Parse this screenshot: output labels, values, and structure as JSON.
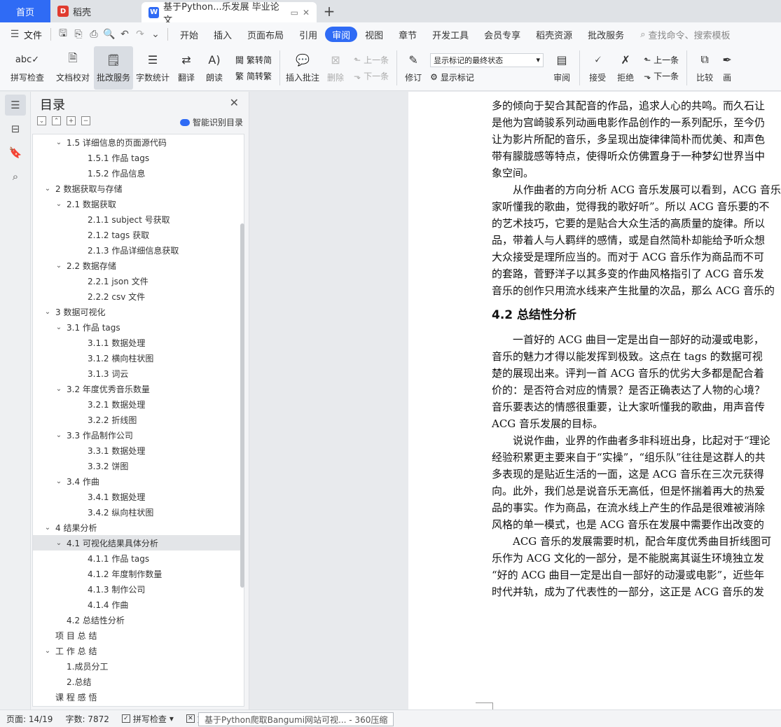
{
  "tabs": {
    "home": "首页",
    "daoke": "稻壳",
    "doc_title": "基于Python...乐发展 毕业论文",
    "add": "+"
  },
  "menu": {
    "file": "文件",
    "items": [
      "开始",
      "插入",
      "页面布局",
      "引用",
      "审阅",
      "视图",
      "章节",
      "开发工具",
      "会员专享",
      "稻壳资源",
      "批改服务"
    ],
    "active": "审阅",
    "search_placeholder": "查找命令、搜索模板"
  },
  "ribbon": {
    "spellcheck": "拼写检查",
    "doc_proof": "文档校对",
    "correction": "批改服务",
    "word_count": "字数统计",
    "translate": "翻译",
    "read_aloud": "朗读",
    "trad_to_simp": "繁转简",
    "simp_to_trad": "简转繁",
    "insert_comment": "插入批注",
    "delete": "删除",
    "prev_comment": "上一条",
    "next_comment": "下一条",
    "track_changes": "修订",
    "markup_state": "显示标记的最终状态",
    "show_markup": "显示标记",
    "review": "审阅",
    "accept": "接受",
    "reject": "拒绝",
    "prev_change": "上一条",
    "next_change": "下一条",
    "compare": "比较",
    "last_partial": "画"
  },
  "toc": {
    "title": "目录",
    "smart": "智能识别目录",
    "items": [
      {
        "level": 2,
        "arrow": true,
        "text": "1.5  详细信息的页面源代码"
      },
      {
        "level": 3,
        "arrow": false,
        "text": "1.5.1  作品 tags"
      },
      {
        "level": 3,
        "arrow": false,
        "text": "1.5.2  作品信息"
      },
      {
        "level": 1,
        "arrow": true,
        "text": "2    数据获取与存储"
      },
      {
        "level": 2,
        "arrow": true,
        "text": "2.1 数据获取"
      },
      {
        "level": 3,
        "arrow": false,
        "text": "2.1.1 subject 号获取"
      },
      {
        "level": 3,
        "arrow": false,
        "text": "2.1.2 tags 获取"
      },
      {
        "level": 3,
        "arrow": false,
        "text": "2.1.3  作品详细信息获取"
      },
      {
        "level": 2,
        "arrow": true,
        "text": "2.2 数据存储"
      },
      {
        "level": 3,
        "arrow": false,
        "text": "2.2.1 json 文件"
      },
      {
        "level": 3,
        "arrow": false,
        "text": "2.2.2 csv 文件"
      },
      {
        "level": 1,
        "arrow": true,
        "text": "3    数据可视化"
      },
      {
        "level": 2,
        "arrow": true,
        "text": "3.1 作品 tags"
      },
      {
        "level": 3,
        "arrow": false,
        "text": "3.1.1  数据处理"
      },
      {
        "level": 3,
        "arrow": false,
        "text": "3.1.2  横向柱状图"
      },
      {
        "level": 3,
        "arrow": false,
        "text": "3.1.3  词云"
      },
      {
        "level": 2,
        "arrow": true,
        "text": "3.2 年度优秀音乐数量"
      },
      {
        "level": 3,
        "arrow": false,
        "text": "3.2.1  数据处理"
      },
      {
        "level": 3,
        "arrow": false,
        "text": "3.2.2  折线图"
      },
      {
        "level": 2,
        "arrow": true,
        "text": "3.3 作品制作公司"
      },
      {
        "level": 3,
        "arrow": false,
        "text": "3.3.1  数据处理"
      },
      {
        "level": 3,
        "arrow": false,
        "text": "3.3.2  饼图"
      },
      {
        "level": 2,
        "arrow": true,
        "text": "3.4 作曲"
      },
      {
        "level": 3,
        "arrow": false,
        "text": "3.4.1  数据处理"
      },
      {
        "level": 3,
        "arrow": false,
        "text": "3.4.2  纵向柱状图"
      },
      {
        "level": 1,
        "arrow": true,
        "text": "4    结果分析"
      },
      {
        "level": 2,
        "arrow": true,
        "text": "4.1  可视化结果具体分析",
        "selected": true
      },
      {
        "level": 3,
        "arrow": false,
        "text": "4.1.1 作品 tags"
      },
      {
        "level": 3,
        "arrow": false,
        "text": "4.1.2 年度制作数量"
      },
      {
        "level": 3,
        "arrow": false,
        "text": "4.1.3 制作公司"
      },
      {
        "level": 3,
        "arrow": false,
        "text": "4.1.4 作曲"
      },
      {
        "level": 2,
        "arrow": false,
        "text": "4.2 总结性分析"
      },
      {
        "level": 1,
        "arrow": false,
        "text": "项 目 总 结"
      },
      {
        "level": 1,
        "arrow": true,
        "text": "工 作 总 结"
      },
      {
        "level": 2,
        "arrow": false,
        "text": "1.成员分工"
      },
      {
        "level": 2,
        "arrow": false,
        "text": "2.总结"
      },
      {
        "level": 1,
        "arrow": false,
        "text": "课 程 感 悟"
      }
    ]
  },
  "document": {
    "lines_before": [
      "多的倾向于契合其配音的作品，追求人心的共鸣。而久石让",
      "是他为宫崎骏系列动画电影作品创作的一系列配乐，至今仍",
      "让为影片所配的音乐，多呈现出旋律律简朴而优美、和声色",
      "带有朦胧感等特点，使得听众仿佛置身于一种梦幻世界当中",
      "象空间。",
      "　　从作曲者的方向分析 ACG 音乐发展可以看到，ACG 音乐",
      "家听懂我的歌曲，觉得我的歌好听”。所以 ACG 音乐要的不",
      "的艺术技巧，它要的是贴合大众生活的高质量的旋律。所以",
      "品，带着人与人羁绊的感情，或是自然简朴却能给予听众想",
      "大众接受是理所应当的。而对于 ACG 音乐作为商品而不可",
      "的套路，菅野洋子以其多变的作曲风格指引了 ACG 音乐发",
      "音乐的创作只用流水线来产生批量的次品，那么 ACG 音乐的"
    ],
    "heading": "4.2 总结性分析",
    "lines_after": [
      "　　一首好的 ACG 曲目一定是出自一部好的动漫或电影，",
      "音乐的魅力才得以能发挥到极致。这点在 tags 的数据可视",
      "楚的展现出来。评判一首 ACG 音乐的优劣大多都是配合着",
      "价的：是否符合对应的情景？是否正确表达了人物的心境？",
      "音乐要表达的情感很重要，让大家听懂我的歌曲，用声音传",
      "ACG 音乐发展的目标。",
      "　　说说作曲，业界的作曲者多非科班出身，比起对于“理论",
      "经验积累更主要来自于“实操”，“组乐队”往往是这群人的共",
      "多表现的是贴近生活的一面，这是 ACG 音乐在三次元获得",
      "向。此外，我们总是说音乐无高低，但是怀揣着再大的热爱",
      "品的事实。作为商品，在流水线上产生的作品是很难被消除",
      "风格的单一模式，也是 ACG 音乐在发展中需要作出改变的",
      "　　ACG 音乐的发展需要时机，配合年度优秀曲目折线图可",
      "乐作为 ACG 文化的一部分，是不能脱离其诞生环境独立发",
      "“好的 ACG 曲目一定是出自一部好的动漫或电影”，近些年",
      "时代并轨，成为了代表性的一部分，这正是 ACG 音乐的发"
    ]
  },
  "status": {
    "page": "页面: 14/19",
    "word_count": "字数: 7872",
    "spellcheck": "拼写检查",
    "doc_partial": "文",
    "tooltip": "基于Python爬取Bangumi网站可视... - 360压缩"
  }
}
